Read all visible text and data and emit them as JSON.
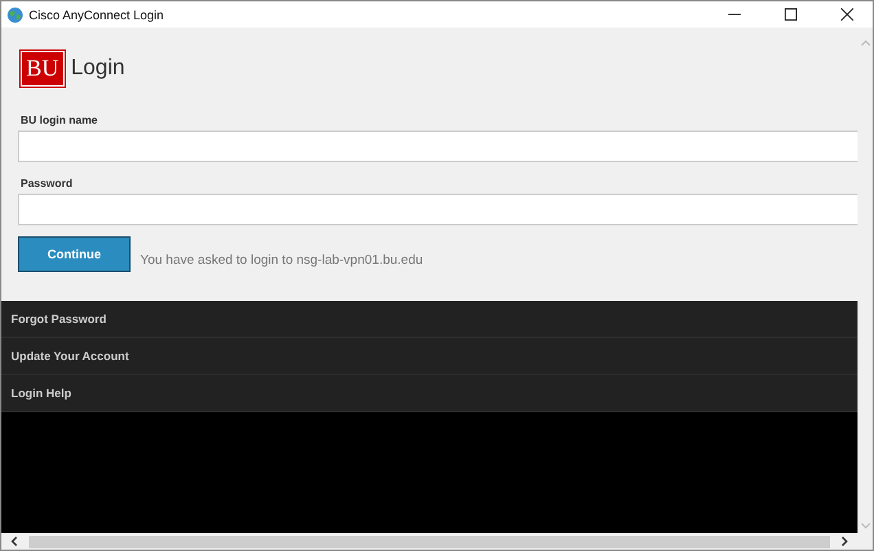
{
  "window": {
    "title": "Cisco AnyConnect Login"
  },
  "header": {
    "logo": "BU",
    "title": "Login"
  },
  "fields": [
    {
      "label": "BU login name"
    },
    {
      "label": "Password"
    }
  ],
  "button": "Continue",
  "message": "You have asked to login to nsg-lab-vpn01.bu.edu",
  "links": [
    "Forgot Password",
    "Update Your Account",
    "Login Help"
  ]
}
